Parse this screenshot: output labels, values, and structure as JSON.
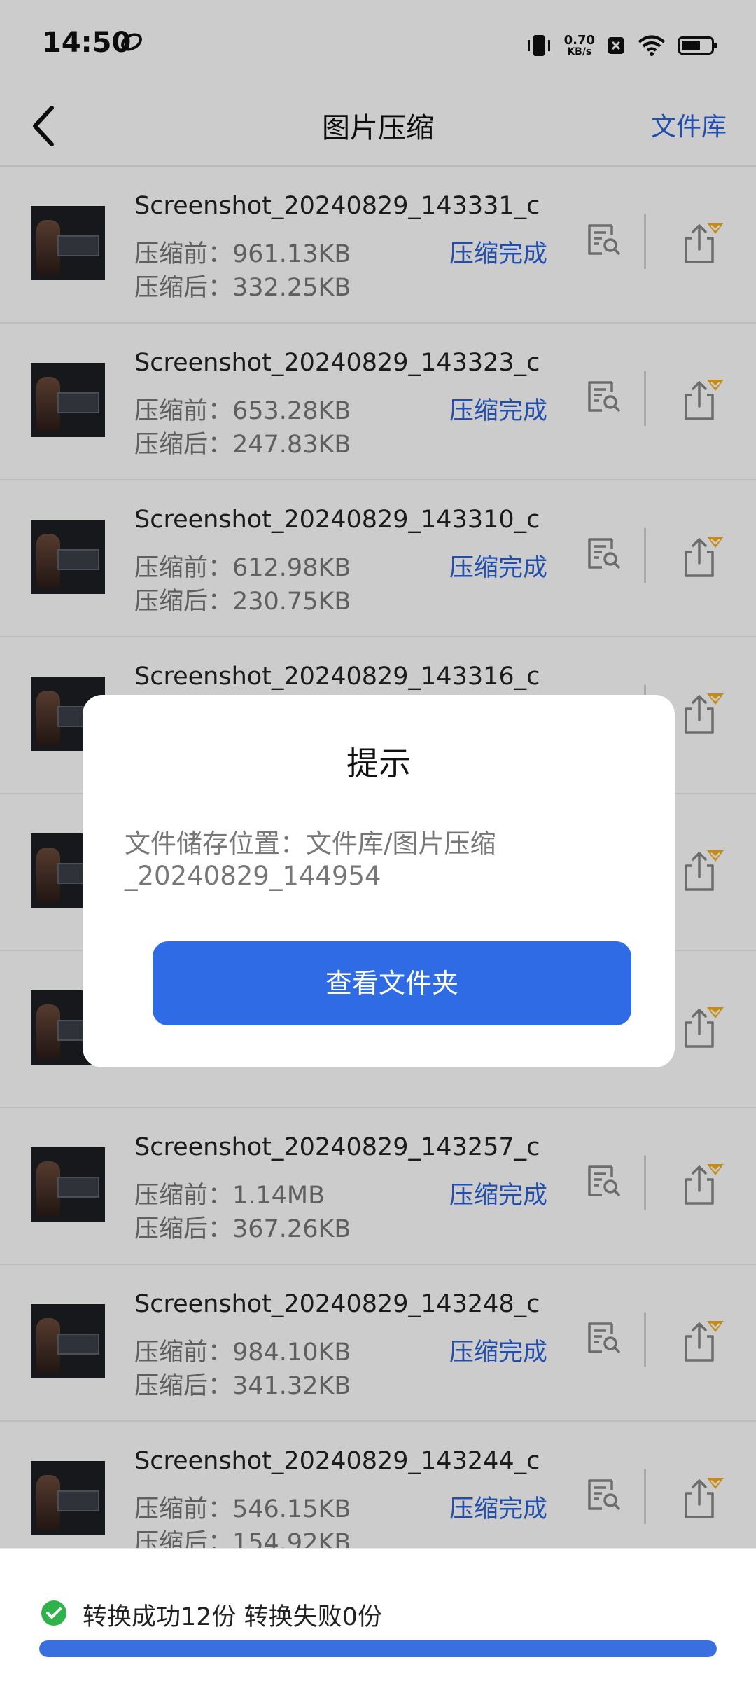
{
  "status_bar": {
    "time": "14:50",
    "net_speed": "0.70",
    "net_unit": "KB/s"
  },
  "header": {
    "title": "图片压缩",
    "right_link": "文件库"
  },
  "list": [
    {
      "name": "Screenshot_20240829_143331_c···",
      "before": "压缩前：961.13KB",
      "after": "压缩后：332.25KB",
      "status": "压缩完成"
    },
    {
      "name": "Screenshot_20240829_143323_c···",
      "before": "压缩前：653.28KB",
      "after": "压缩后：247.83KB",
      "status": "压缩完成"
    },
    {
      "name": "Screenshot_20240829_143310_c···",
      "before": "压缩前：612.98KB",
      "after": "压缩后：230.75KB",
      "status": "压缩完成"
    },
    {
      "name": "Screenshot_20240829_143316_c···",
      "before": "",
      "after": "",
      "status": ""
    },
    {
      "name": "",
      "before": "",
      "after": "",
      "status": ""
    },
    {
      "name": "",
      "before": "",
      "after": "",
      "status": ""
    },
    {
      "name": "Screenshot_20240829_143257_c···",
      "before": "压缩前：1.14MB",
      "after": "压缩后：367.26KB",
      "status": "压缩完成"
    },
    {
      "name": "Screenshot_20240829_143248_c···",
      "before": "压缩前：984.10KB",
      "after": "压缩后：341.32KB",
      "status": "压缩完成"
    },
    {
      "name": "Screenshot_20240829_143244_c···",
      "before": "压缩前：546.15KB",
      "after": "压缩后：154.92KB",
      "status": "压缩完成"
    }
  ],
  "dialog": {
    "title": "提示",
    "message": "文件储存位置：文件库/图片压缩_20240829_144954",
    "button": "查看文件夹"
  },
  "bottom": {
    "result": "转换成功12份 转换失败0份",
    "progress_fraction": 1.0
  },
  "colors": {
    "accent": "#2f6be4",
    "link": "#2b62d9",
    "success": "#2db34a",
    "badge": "#f2b01e"
  }
}
